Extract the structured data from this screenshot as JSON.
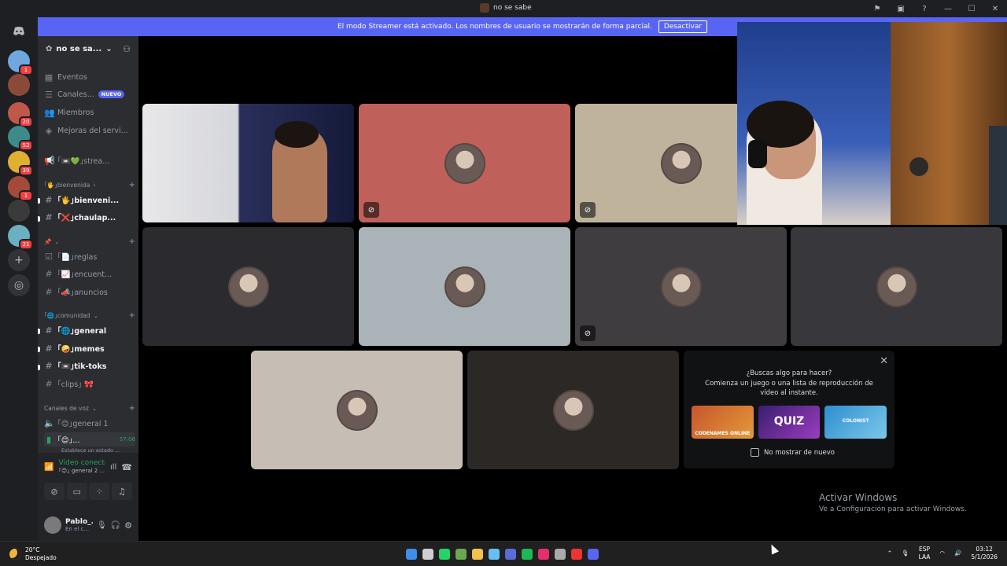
{
  "window": {
    "title": "no se sabe",
    "controls": [
      "⚑",
      "▣",
      "?",
      "—",
      "☐",
      "✕"
    ]
  },
  "banner": {
    "text": "El modo Streamer está activado. Los nombres de usuario se mostrarán de forma parcial.",
    "button": "Desactivar"
  },
  "guilds": [
    {
      "badge": "1",
      "color": "#6fa8dc"
    },
    {
      "badge": "",
      "color": "#8a4a3a"
    },
    {
      "badge": "20",
      "color": "#c0584a"
    },
    {
      "badge": "52",
      "color": "#3d8a8a"
    },
    {
      "badge": "39",
      "color": "#e0b030"
    },
    {
      "badge": "1",
      "color": "#a34a3a"
    },
    {
      "badge": "",
      "color": "#3a3a3a"
    },
    {
      "badge": "21",
      "color": "#6ab0c0"
    }
  ],
  "server": {
    "name": "no se sa...",
    "events": "Eventos",
    "channels": "Canales...",
    "new_badge": "NUEVO",
    "members": "Miembros",
    "boosts": "Mejoras del servi...",
    "stream": "｢📼💚｣strea...",
    "cat_welcome": "｢🖐｣bienvenida",
    "welcome": "｢🖐｣bienveni...",
    "chaulap": "｢❌｣chaulap...",
    "cat_pin": "📌",
    "reglas": "｢📄｣reglas",
    "encuent": "｢📈｣encuent...",
    "anuncios": "｢📣｣anuncios",
    "cat_community": "｢🌐｣comunidad",
    "general": "｢🌐｣general",
    "memes": "｢🤪｣memes",
    "tiktoks": "｢📼｣tik-toks",
    "clips": "｢clips｣ 🎀",
    "cat_voice": "Canales de voz",
    "voice_general": "｢😊｣general 1",
    "voice_active": "｢😊｣...",
    "voice_time": "57:06",
    "status_set": "Establece un estado ..."
  },
  "voice_panel": {
    "status": "Vídeo conectac",
    "channel": "｢😊｣ general 2 ...",
    "user": "Pablo_...",
    "user_status": "En el c..."
  },
  "tiles": [
    {
      "bg": "#3a3d55",
      "mute": false,
      "video": true
    },
    {
      "bg": "#c0605a",
      "mute": true
    },
    {
      "bg": "#bfb39c",
      "mute": true
    },
    {
      "bg": "#2b2a2f",
      "mute": false
    },
    {
      "bg": "#a9b3b8",
      "mute": false
    },
    {
      "bg": "#403d40",
      "mute": true
    },
    {
      "bg": "#38373b",
      "mute": false
    },
    {
      "bg": "#c6beb5",
      "mute": false
    },
    {
      "bg": "#2b2826",
      "mute": false
    }
  ],
  "promo": {
    "question": "¿Buscas algo para hacer?",
    "subtitle": "Comienza un juego o una lista de reproducción de vídeo al instante.",
    "games": [
      "CODENAMES ONLINE",
      "QUIZ",
      "COLONIST"
    ],
    "checkbox": "No mostrar de nuevo"
  },
  "activate": {
    "title": "Activar Windows",
    "subtitle": "Ve a Configuración para activar Windows."
  },
  "taskbar": {
    "temp": "20°C",
    "weather": "Despejado",
    "lang1": "ESP",
    "lang2": "LAA",
    "time": "03:12",
    "date": "5/1/2026",
    "apps": [
      "#3b8eea",
      "#cfcfcf",
      "#25d366",
      "#6aa84f",
      "#f2c14e",
      "#66c0f4",
      "#5b6bd8",
      "#1db954",
      "#e1306c",
      "#aaaaaa",
      "#e33",
      "#5865f2"
    ]
  }
}
